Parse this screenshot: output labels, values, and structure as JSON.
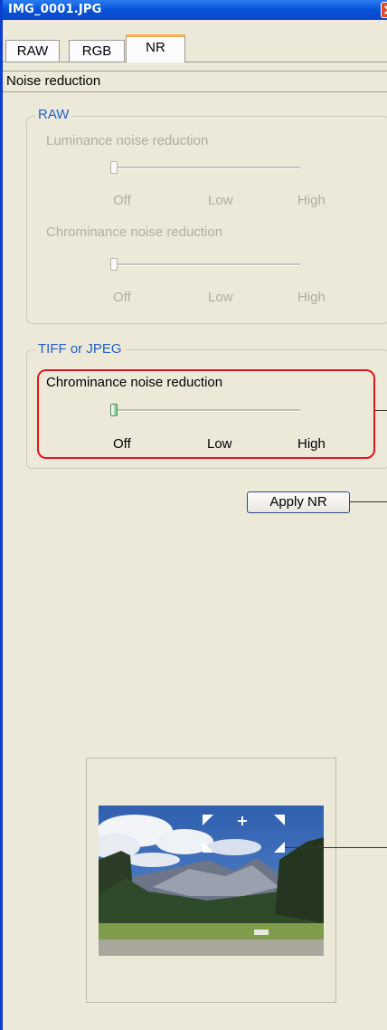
{
  "window": {
    "title": "IMG_0001.JPG"
  },
  "tabs": [
    {
      "label": "RAW"
    },
    {
      "label": "RGB"
    },
    {
      "label": "NR"
    }
  ],
  "section": {
    "title": "Noise reduction"
  },
  "raw_group": {
    "legend": "RAW",
    "luminance": {
      "label": "Luminance noise reduction",
      "ticks": [
        "Off",
        "Low",
        "High"
      ],
      "value": 0
    },
    "chrominance": {
      "label": "Chrominance noise reduction",
      "ticks": [
        "Off",
        "Low",
        "High"
      ],
      "value": 0
    }
  },
  "tiff_group": {
    "legend": "TIFF or JPEG",
    "chrominance": {
      "label": "Chrominance noise reduction",
      "ticks": [
        "Off",
        "Low",
        "High"
      ],
      "value": 0
    }
  },
  "apply": {
    "label": "Apply NR"
  },
  "colors": {
    "titlebar": "#0653d8",
    "accent": "#1f5fc8",
    "highlight": "#e2151f",
    "tab_active": "#f6b24a"
  }
}
